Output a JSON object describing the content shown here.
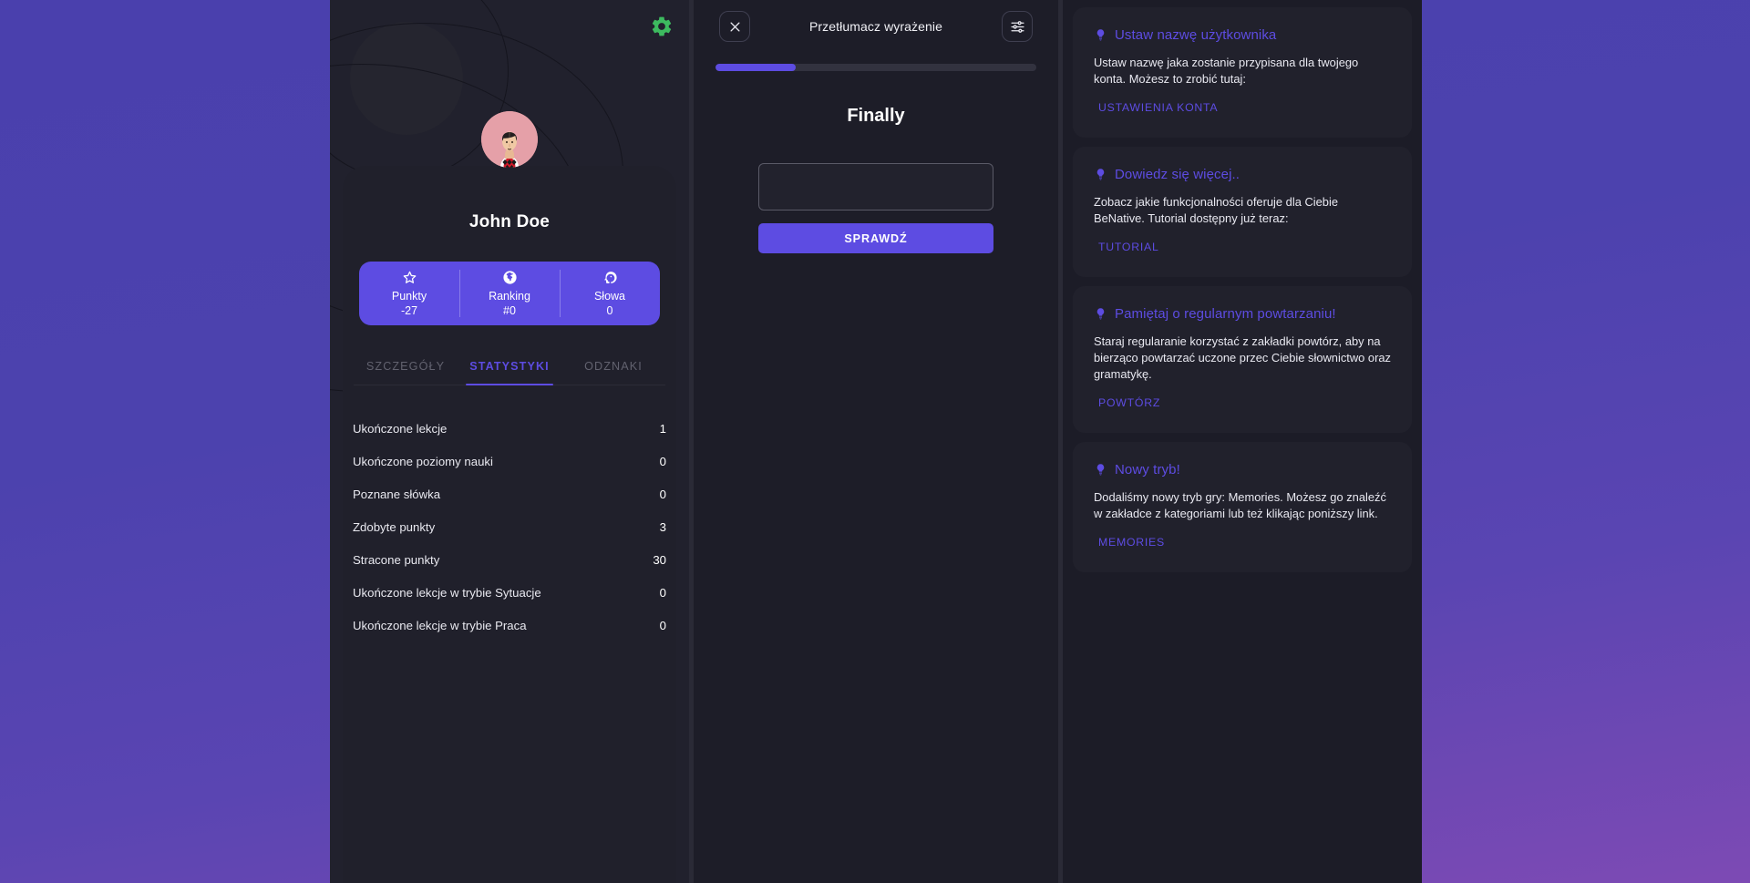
{
  "theme": {
    "accent": "#5d4ce2",
    "gear_green": "#3dba5f",
    "panel_bg": "#21212d",
    "card_bg": "#21212c",
    "page_gradient_from": "#4a40ad",
    "page_gradient_to": "#7d4ab4"
  },
  "profile": {
    "gear_icon": "gear-icon",
    "avatar_icon": "user-avatar",
    "name": "John Doe",
    "stats_pill": [
      {
        "icon": "star-icon",
        "label": "Punkty",
        "value": "-27"
      },
      {
        "icon": "globe-icon",
        "label": "Ranking",
        "value": "#0"
      },
      {
        "icon": "brain-icon",
        "label": "Słowa",
        "value": "0"
      }
    ],
    "tabs": [
      {
        "label": "SZCZEGÓŁY",
        "active": false
      },
      {
        "label": "STATYSTYKI",
        "active": true
      },
      {
        "label": "ODZNAKI",
        "active": false
      }
    ],
    "statistics": [
      {
        "label": "Ukończone lekcje",
        "value": "1"
      },
      {
        "label": "Ukończone poziomy nauki",
        "value": "0"
      },
      {
        "label": "Poznane słówka",
        "value": "0"
      },
      {
        "label": "Zdobyte punkty",
        "value": "3"
      },
      {
        "label": "Stracone punkty",
        "value": "30"
      },
      {
        "label": "Ukończone lekcje w trybie Sytuacje",
        "value": "0"
      },
      {
        "label": "Ukończone lekcje w trybie Praca",
        "value": "0"
      }
    ]
  },
  "translate": {
    "close_icon": "close-icon",
    "settings_icon": "sliders-icon",
    "title": "Przetłumacz wyrażenie",
    "progress_percent": 25,
    "prompt_word": "Finally",
    "answer_value": "",
    "answer_placeholder": "",
    "submit_label": "SPRAWDŹ"
  },
  "tips": [
    {
      "icon": "lightbulb-icon",
      "title": "Ustaw nazwę użytkownika",
      "body": "Ustaw nazwę jaka zostanie przypisana dla twojego konta. Możesz to zrobić tutaj:",
      "link": "USTAWIENIA KONTA"
    },
    {
      "icon": "lightbulb-icon",
      "title": "Dowiedz się więcej..",
      "body": "Zobacz jakie funkcjonalności oferuje dla Ciebie BeNative. Tutorial dostępny już teraz:",
      "link": "TUTORIAL"
    },
    {
      "icon": "lightbulb-icon",
      "title": "Pamiętaj o regularnym powtarzaniu!",
      "body": "Staraj regularanie korzystać z zakładki powtórz, aby na bierząco powtarzać uczone przec Ciebie słownictwo oraz gramatykę.",
      "link": "POWTÓRZ"
    },
    {
      "icon": "lightbulb-icon",
      "title": "Nowy tryb!",
      "body": "Dodaliśmy nowy tryb gry: Memories. Możesz go znaleźć w zakładce z kategoriami lub też klikając poniższy link.",
      "link": "MEMORIES"
    }
  ]
}
